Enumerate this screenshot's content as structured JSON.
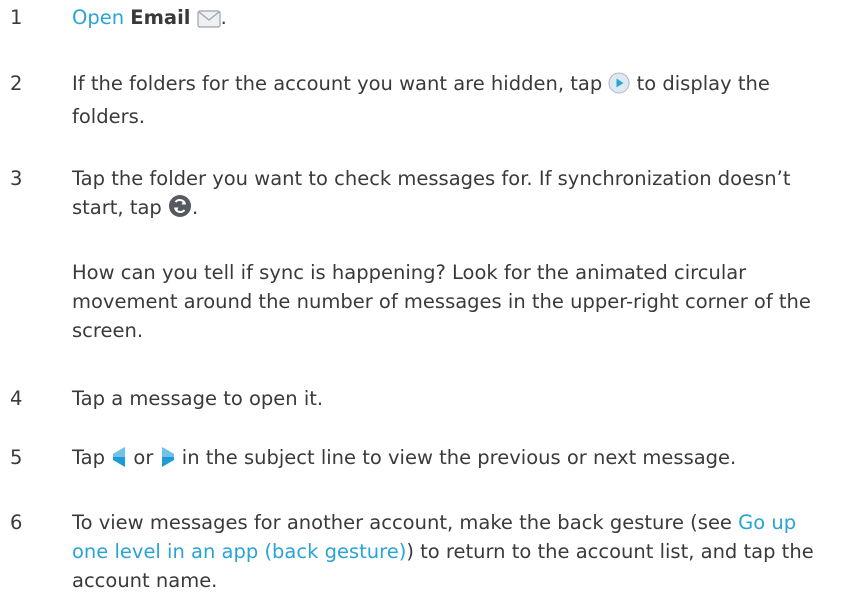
{
  "steps": [
    {
      "num": "1",
      "link": "Open",
      "app": "Email",
      "end": "."
    },
    {
      "num": "2",
      "before": "If the folders for the account you want are hidden, tap",
      "after": "to display the folders."
    },
    {
      "num": "3",
      "before": "Tap the folder you want to check messages for. If synchronization doesn’t start, tap",
      "after": ".",
      "note": "How can you tell if sync is happening? Look for the animated circular movement around the number of messages in the upper-right corner of the screen."
    },
    {
      "num": "4",
      "text": "Tap a message to open it."
    },
    {
      "num": "5",
      "before": "Tap",
      "mid": "or",
      "after": "in the subject line to view the previous or next message."
    },
    {
      "num": "6",
      "before": "To view messages for another account, make the back gesture (see",
      "link": "Go up one level in an app (back gesture)",
      "after": ") to return to the account list, and tap the account name."
    }
  ],
  "icons": {
    "email": "envelope-icon",
    "expand": "play-circle-icon",
    "sync": "sync-icon",
    "previous": "left-arrow-icon",
    "next": "right-arrow-icon"
  },
  "colors": {
    "link": "#2aa3d6",
    "text": "#3a3a3a",
    "arrow": "#1e9bd7"
  }
}
